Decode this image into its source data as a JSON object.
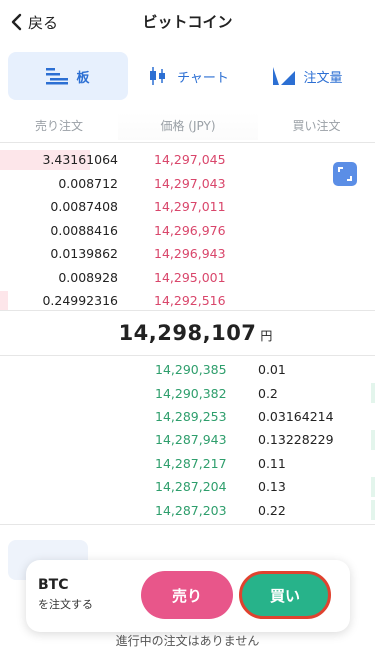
{
  "header": {
    "back_label": "戻る",
    "title": "ビットコイン"
  },
  "tabs": [
    {
      "label": "板",
      "icon": "orderbook-icon",
      "active": true
    },
    {
      "label": "チャート",
      "icon": "candlestick-icon",
      "active": false
    },
    {
      "label": "注文量",
      "icon": "volume-icon",
      "active": false
    }
  ],
  "columns": {
    "sell": "売り注文",
    "price": "価格 (JPY)",
    "buy": "買い注文"
  },
  "asks": [
    {
      "qty": "3.43161064",
      "price": "14,297,045",
      "depth_pct": 24
    },
    {
      "qty": "0.008712",
      "price": "14,297,043",
      "depth_pct": 0
    },
    {
      "qty": "0.0087408",
      "price": "14,297,011",
      "depth_pct": 0
    },
    {
      "qty": "0.0088416",
      "price": "14,296,976",
      "depth_pct": 0
    },
    {
      "qty": "0.0139862",
      "price": "14,296,943",
      "depth_pct": 0
    },
    {
      "qty": "0.008928",
      "price": "14,295,001",
      "depth_pct": 0
    },
    {
      "qty": "0.24992316",
      "price": "14,292,516",
      "depth_pct": 2
    }
  ],
  "mid": {
    "price": "14,298,107",
    "unit": "円"
  },
  "bids": [
    {
      "price": "14,290,385",
      "qty": "0.01",
      "depth_pct": 0
    },
    {
      "price": "14,290,382",
      "qty": "0.2",
      "depth_pct": 1
    },
    {
      "price": "14,289,253",
      "qty": "0.03164214",
      "depth_pct": 0
    },
    {
      "price": "14,287,943",
      "qty": "0.13228229",
      "depth_pct": 1
    },
    {
      "price": "14,287,217",
      "qty": "0.11",
      "depth_pct": 0
    },
    {
      "price": "14,287,204",
      "qty": "0.13",
      "depth_pct": 1
    },
    {
      "price": "14,287,203",
      "qty": "0.22",
      "depth_pct": 1
    }
  ],
  "order": {
    "symbol": "BTC",
    "subtitle": "を注文する",
    "sell_label": "売り",
    "buy_label": "買い"
  },
  "footer": {
    "note": "進行中の注文はありません"
  },
  "colors": {
    "ask": "#d9466b",
    "bid": "#2e9e6c",
    "accent": "#2c6fd3",
    "sell_button": "#e8568a",
    "buy_button": "#27b38a"
  }
}
